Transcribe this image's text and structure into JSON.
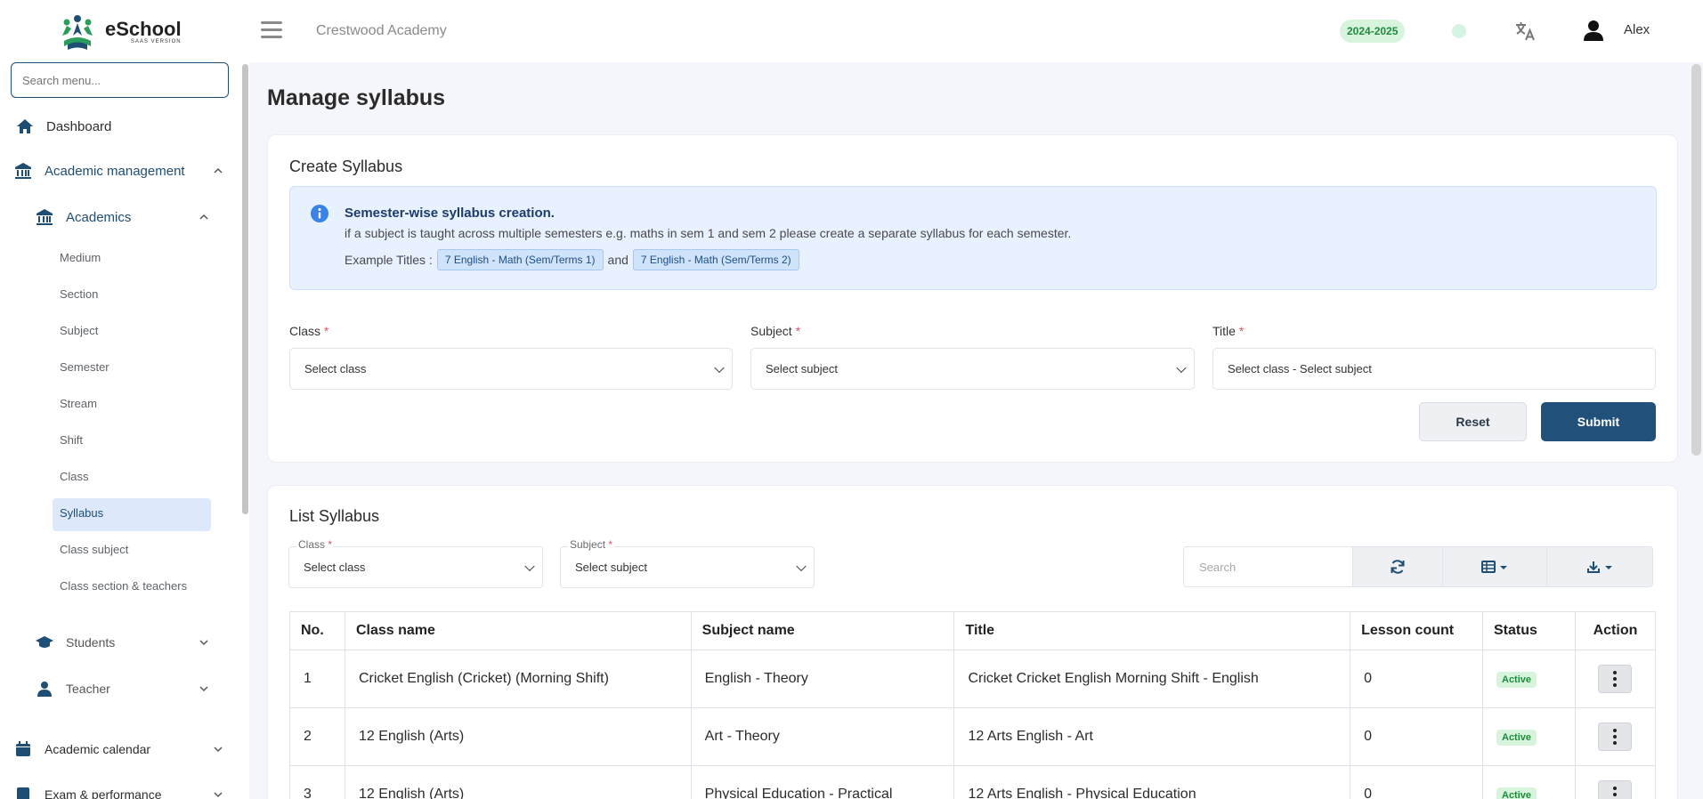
{
  "brand": {
    "name": "eSchool",
    "sub": "SAAS VERSION"
  },
  "sidebar": {
    "search_placeholder": "Search menu...",
    "items": [
      {
        "label": "Dashboard"
      },
      {
        "label": "Academic management"
      },
      {
        "label": "Academics"
      },
      {
        "label": "Students"
      },
      {
        "label": "Teacher"
      },
      {
        "label": "Academic calendar"
      },
      {
        "label": "Exam & performance"
      }
    ],
    "subitems": [
      "Medium",
      "Section",
      "Subject",
      "Semester",
      "Stream",
      "Shift",
      "Class",
      "Syllabus",
      "Class subject",
      "Class section & teachers"
    ]
  },
  "header": {
    "school": "Crestwood Academy",
    "session": "2024-2025",
    "user": "Alex"
  },
  "page": {
    "title": "Manage syllabus"
  },
  "create": {
    "title": "Create Syllabus",
    "alert_title": "Semester-wise syllabus creation.",
    "alert_text": "if a subject is taught across multiple semesters e.g. maths in sem 1 and sem 2 please create a separate syllabus for each semester.",
    "examples_label": "Example Titles :",
    "example1": "7 English - Math (Sem/Terms 1)",
    "joiner": "and",
    "example2": "7 English - Math (Sem/Terms 2)",
    "class_label": "Class",
    "class_value": "Select class",
    "subject_label": "Subject",
    "subject_value": "Select subject",
    "title_label": "Title",
    "title_value": "Select class - Select subject",
    "required": "*",
    "reset": "Reset",
    "submit": "Submit"
  },
  "list": {
    "title": "List Syllabus",
    "class_label": "Class",
    "class_value": "Select class",
    "subject_label": "Subject",
    "subject_value": "Select subject",
    "required": "*",
    "search_placeholder": "Search",
    "columns": [
      "No.",
      "Class name",
      "Subject name",
      "Title",
      "Lesson count",
      "Status",
      "Action"
    ],
    "rows": [
      [
        "1",
        "Cricket English (Cricket) (Morning Shift)",
        "English - Theory",
        "Cricket Cricket English Morning Shift - English",
        "0",
        "Active"
      ],
      [
        "2",
        "12 English (Arts)",
        "Art - Theory",
        "12 Arts English - Art",
        "0",
        "Active"
      ],
      [
        "3",
        "12 English (Arts)",
        "Physical Education - Practical",
        "12 Arts English - Physical Education",
        "0",
        "Active"
      ]
    ]
  },
  "colors": {
    "primary": "#21507a",
    "active_badge_bg": "#d7f5dd",
    "active_badge_fg": "#1f8a3b",
    "alert_bg": "#e7f1ff"
  }
}
